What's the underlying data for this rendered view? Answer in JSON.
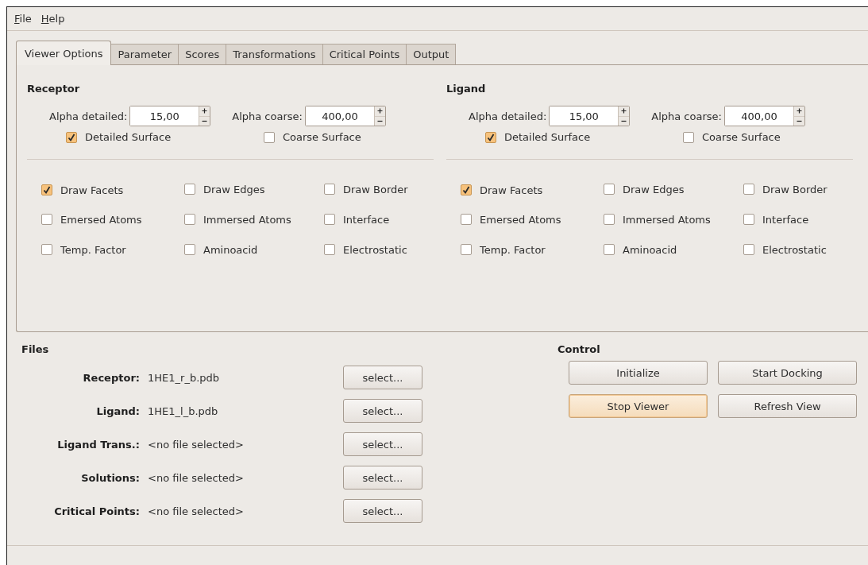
{
  "menu": [
    {
      "label": "File"
    },
    {
      "label": "Help"
    }
  ],
  "tabs": [
    {
      "label": "Viewer Options",
      "selected": true
    },
    {
      "label": "Parameter",
      "selected": false
    },
    {
      "label": "Scores",
      "selected": false
    },
    {
      "label": "Transformations",
      "selected": false
    },
    {
      "label": "Critical Points",
      "selected": false
    },
    {
      "label": "Output",
      "selected": false
    }
  ],
  "panels": [
    {
      "title": "Receptor",
      "spinboxes": [
        {
          "label": "Alpha detailed:",
          "value": "15,00"
        },
        {
          "label": "Alpha coarse:",
          "value": "400,00"
        }
      ],
      "surfaces": [
        {
          "label": "Detailed Surface",
          "checked": true
        },
        {
          "label": "Coarse Surface",
          "checked": false
        }
      ],
      "options": [
        {
          "label": "Draw Facets",
          "checked": true
        },
        {
          "label": "Draw Edges",
          "checked": false
        },
        {
          "label": "Draw Border",
          "checked": false
        },
        {
          "label": "Emersed Atoms",
          "checked": false
        },
        {
          "label": "Immersed Atoms",
          "checked": false
        },
        {
          "label": "Interface",
          "checked": false
        },
        {
          "label": "Temp. Factor",
          "checked": false
        },
        {
          "label": "Aminoacid",
          "checked": false
        },
        {
          "label": "Electrostatic",
          "checked": false
        }
      ]
    },
    {
      "title": "Ligand",
      "spinboxes": [
        {
          "label": "Alpha detailed:",
          "value": "15,00"
        },
        {
          "label": "Alpha coarse:",
          "value": "400,00"
        }
      ],
      "surfaces": [
        {
          "label": "Detailed Surface",
          "checked": true
        },
        {
          "label": "Coarse Surface",
          "checked": false
        }
      ],
      "options": [
        {
          "label": "Draw Facets",
          "checked": true
        },
        {
          "label": "Draw Edges",
          "checked": false
        },
        {
          "label": "Draw Border",
          "checked": false
        },
        {
          "label": "Emersed Atoms",
          "checked": false
        },
        {
          "label": "Immersed Atoms",
          "checked": false
        },
        {
          "label": "Interface",
          "checked": false
        },
        {
          "label": "Temp. Factor",
          "checked": false
        },
        {
          "label": "Aminoacid",
          "checked": false
        },
        {
          "label": "Electrostatic",
          "checked": false
        }
      ]
    }
  ],
  "files": {
    "title": "Files",
    "rows": [
      {
        "label": "Receptor:",
        "value": "1HE1_r_b.pdb",
        "button": "select..."
      },
      {
        "label": "Ligand:",
        "value": "1HE1_l_b.pdb",
        "button": "select..."
      },
      {
        "label": "Ligand Trans.:",
        "value": "<no file selected>",
        "button": "select..."
      },
      {
        "label": "Solutions:",
        "value": "<no file selected>",
        "button": "select..."
      },
      {
        "label": "Critical Points:",
        "value": "<no file selected>",
        "button": "select..."
      }
    ]
  },
  "control": {
    "title": "Control",
    "buttons": [
      {
        "label": "Initialize",
        "highlighted": false
      },
      {
        "label": "Start Docking",
        "highlighted": false
      },
      {
        "label": "Stop Viewer",
        "highlighted": true
      },
      {
        "label": "Refresh View",
        "highlighted": false
      }
    ]
  }
}
